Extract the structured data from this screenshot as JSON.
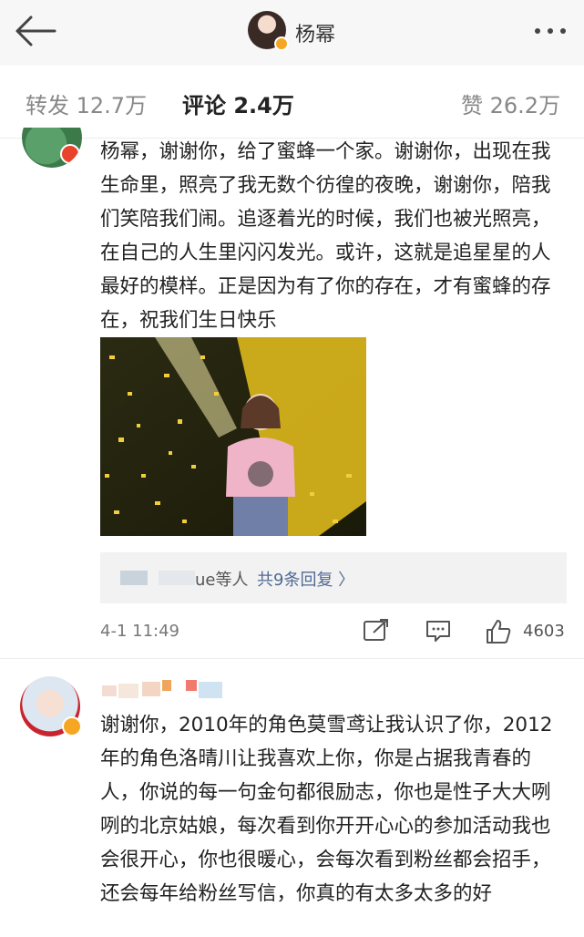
{
  "header": {
    "user_name": "杨幂"
  },
  "tabs": {
    "repost": "转发 12.7万",
    "comment": "评论 2.4万",
    "like": "赞 26.2万"
  },
  "comments": [
    {
      "text": "杨幂，谢谢你，给了蜜蜂一个家。谢谢你，出现在我生命里，照亮了我无数个彷徨的夜晚，谢谢你，陪我们笑陪我们闹。追逐着光的时候，我们也被光照亮，在自己的人生里闪闪发光。或许，这就是追星星的人最好的模样。正是因为有了你的存在，才有蜜蜂的存在，祝我们生日快乐",
      "reply_preview": "ue等人",
      "reply_count": "共9条回复 〉",
      "time": "4-1 11:49",
      "likes": "4603"
    },
    {
      "text": "谢谢你，2010年的角色莫雪鸢让我认识了你，2012年的角色洛晴川让我喜欢上你，你是占据我青春的人，你说的每一句金句都很励志，你也是性子大大咧咧的北京姑娘，每次看到你开开心心的参加活动我也会很开心，你也很暖心，会每次看到粉丝都会招手，还会每年给粉丝写信，你真的有太多太多的好"
    }
  ],
  "icons": {
    "back": "back-arrow-icon",
    "more": "more-icon",
    "repost": "repost-icon",
    "comment": "comment-icon",
    "like": "thumbs-up-icon"
  },
  "colors": {
    "link": "#506a94",
    "verified_orange": "#f5a623",
    "verified_red": "#e8432b"
  }
}
